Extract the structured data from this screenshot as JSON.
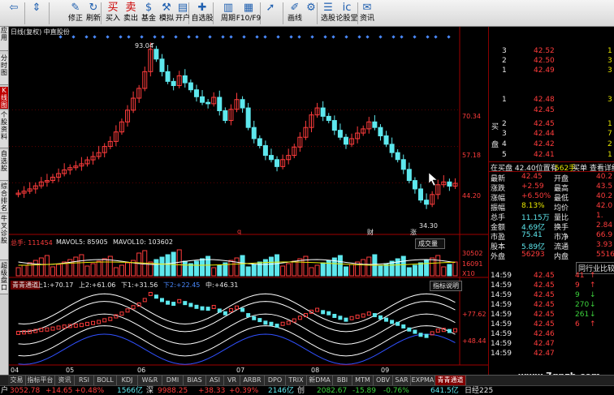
{
  "toolbar": {
    "buttons": [
      {
        "label": "",
        "icon": "back-arrow-icon"
      },
      {
        "label": "",
        "icon": "up-down-icon"
      },
      {
        "label": "修正",
        "icon": "edit-icon"
      },
      {
        "label": "刷新",
        "icon": "refresh-icon"
      },
      {
        "label": "买入",
        "icon": "buy-icon"
      },
      {
        "label": "卖出",
        "icon": "sell-icon"
      },
      {
        "label": "基金",
        "icon": "fund-icon"
      },
      {
        "label": "模拟",
        "icon": "simulate-icon"
      },
      {
        "label": "开户",
        "icon": "open-account-icon"
      },
      {
        "label": "自选股",
        "icon": "watchlist-icon"
      },
      {
        "label": "",
        "icon": "zoom-icon"
      },
      {
        "label": "周期",
        "icon": "period-icon"
      },
      {
        "label": "F10/F9",
        "icon": "f10-icon"
      },
      {
        "label": "",
        "icon": "arrow-icon"
      },
      {
        "label": "画线",
        "icon": "draw-line-icon"
      },
      {
        "label": "",
        "icon": "tools-icon"
      },
      {
        "label": "选股",
        "icon": "stock-pick-icon"
      },
      {
        "label": "论股堂",
        "icon": "forum-icon"
      },
      {
        "label": "资讯",
        "icon": "news-icon"
      }
    ]
  },
  "sidebar": {
    "tabs": [
      "应用",
      "分时图",
      "K线图",
      "个股资料",
      "自选股",
      "综合排名",
      "牛叉诊股",
      "超级盘口"
    ]
  },
  "chart": {
    "header": "日线(复权)  中直股份",
    "peak_label": "93.04",
    "low_label": "34.30",
    "price_ticks": [
      "70.34",
      "57.18",
      "44.20"
    ],
    "volume_header": {
      "label1": "总手: 111454",
      "label2": "MAVOL5: 85905",
      "label3": "MAVOL10: 103602"
    },
    "volume_ticks": [
      "30502",
      "16091",
      "X10"
    ],
    "volume_button": "成交量",
    "indicator_header": {
      "name": "青青通道",
      "items": [
        "上1:+70.17",
        "上2:+61.06",
        "下1:+31.56",
        "下2:+22.45",
        "中:+46.31"
      ]
    },
    "indicator_button": "指标说明",
    "indicator_ticks": [
      "+77.62",
      "+48.44"
    ],
    "x_labels": [
      "04",
      "05",
      "06",
      "07",
      "08",
      "09"
    ],
    "event_markers": [
      "q",
      "财",
      "涨"
    ]
  },
  "chart_data": {
    "type": "candlestick",
    "title": "日线(复权) 中直股份",
    "ylim": [
      26,
      96
    ],
    "x_labels": [
      "04",
      "05",
      "06",
      "07",
      "08",
      "09"
    ],
    "annotations": {
      "high": 93.04,
      "low": 34.3
    },
    "price_ticks": [
      70.34,
      57.18,
      44.2
    ],
    "close": [
      40.5,
      41.2,
      42.0,
      43.1,
      44.5,
      45.0,
      46.2,
      47.5,
      48.8,
      49.6,
      50.2,
      51.0,
      52.4,
      53.6,
      55.0,
      57.2,
      59.0,
      62.4,
      66.0,
      70.2,
      74.5,
      78.0,
      84.0,
      92.0,
      88.5,
      84.0,
      80.5,
      79.0,
      82.5,
      80.0,
      77.5,
      75.0,
      73.0,
      72.5,
      74.8,
      70.0,
      66.5,
      70.5,
      74.0,
      71.0,
      64.0,
      60.0,
      57.5,
      54.0,
      52.5,
      50.0,
      52.5,
      54.0,
      57.0,
      60.5,
      64.0,
      68.5,
      71.0,
      68.0,
      66.5,
      63.0,
      60.5,
      58.0,
      60.0,
      62.0,
      63.5,
      66.0,
      64.0,
      61.0,
      58.0,
      55.0,
      52.5,
      49.0,
      45.0,
      42.0,
      38.0,
      36.5,
      40.0,
      43.5,
      44.5,
      43.0,
      44.0
    ],
    "volume_ticks": [
      30502,
      16091
    ],
    "indicator": {
      "name": "青青通道",
      "upper1": 70.17,
      "upper2": 61.06,
      "lower1": 31.56,
      "lower2": 22.45,
      "mid": 46.31,
      "ticks": [
        77.62,
        48.44
      ]
    }
  },
  "quote": {
    "buy_label": "买",
    "sell_label": "盘",
    "bid_rows": [
      {
        "level": "1",
        "price": "42.48",
        "vol": "3"
      },
      {
        "level": "",
        "price": "42.45",
        "vol": ""
      },
      {
        "level": "2",
        "price": "42.45",
        "vol": "1"
      },
      {
        "level": "3",
        "price": "42.44",
        "vol": "7"
      },
      {
        "level": "4",
        "price": "42.42",
        "vol": "2"
      },
      {
        "level": "5",
        "price": "42.41",
        "vol": "1"
      }
    ],
    "ask_rows": [
      {
        "level": "1",
        "price": "42.49",
        "vol": "3"
      },
      {
        "level": "2",
        "price": "42.50",
        "vol": "3"
      },
      {
        "level": "3",
        "price": "42.52",
        "vol": "1"
      }
    ],
    "summary_left": "在买盘 42.40位置有",
    "summary_mid": "562手",
    "summary_right": "买单 查看详细",
    "stats": [
      {
        "l": "最新",
        "v": "42.45",
        "l2": "开盘",
        "v2": "40.2"
      },
      {
        "l": "涨跌",
        "v": "+2.59",
        "l2": "最高",
        "v2": "43.5"
      },
      {
        "l": "涨幅",
        "v": "+6.50%",
        "l2": "最低",
        "v2": "40.2"
      },
      {
        "l": "振幅",
        "v": "8.13%",
        "l2": "均价",
        "v2": "42.0"
      },
      {
        "l": "总手",
        "v": "11.15万",
        "l2": "量比",
        "v2": "1."
      },
      {
        "l": "金额",
        "v": "4.69亿",
        "l2": "换手",
        "v2": "2.84"
      },
      {
        "l": "市盈",
        "v": "75.41",
        "l2": "市净",
        "v2": "66.9"
      },
      {
        "l": "股本",
        "v": "5.89亿",
        "l2": "流通",
        "v2": "3.93"
      },
      {
        "l": "外盘",
        "v": "56293",
        "l2": "内盘",
        "v2": "5516"
      }
    ],
    "ticks_title": "同行业比较",
    "ticks": [
      {
        "t": "14:59",
        "p": "42.45",
        "v": "41",
        "c": "red"
      },
      {
        "t": "14:59",
        "p": "42.45",
        "v": "9",
        "c": "red"
      },
      {
        "t": "14:59",
        "p": "42.45",
        "v": "9",
        "c": "green"
      },
      {
        "t": "14:59",
        "p": "42.45",
        "v": "270",
        "c": "green"
      },
      {
        "t": "14:59",
        "p": "42.45",
        "v": "261",
        "c": "green"
      },
      {
        "t": "14:59",
        "p": "42.45",
        "v": "6",
        "c": "red"
      },
      {
        "t": "14:59",
        "p": "42.46",
        "v": "",
        "c": "red"
      },
      {
        "t": "14:59",
        "p": "42.47",
        "v": "",
        "c": "red"
      },
      {
        "t": "14:59",
        "p": "42.47",
        "v": "",
        "c": "red"
      }
    ],
    "watermark": "www.7gpzb.com"
  },
  "tabs": [
    "交易",
    "指标平台",
    "资讯",
    "RSI",
    "BOLL",
    "KDJ",
    "W&R",
    "DMI",
    "BIAS",
    "ASI",
    "VR",
    "ARBR",
    "DPO",
    "TRIX",
    "新DMA",
    "BBI",
    "MTM",
    "OBV",
    "SAR",
    "EXPMA",
    "青青通道"
  ],
  "status": {
    "sh_label": "户",
    "sh_val": "3052.78",
    "sh_chg": "+14.65",
    "sh_pct": "+0.48%",
    "sh_amt": "1566亿",
    "sz_label": "深",
    "sz_val": "9988.25",
    "sz_chg": "+38.33",
    "sz_pct": "+0.39%",
    "sz_amt": "2146亿",
    "cy_label": "创",
    "cy_val": "2082.67",
    "cy_chg": "-15.89",
    "cy_pct": "-0.76%",
    "cy_amt": "641.5亿",
    "tail": "日经225"
  }
}
